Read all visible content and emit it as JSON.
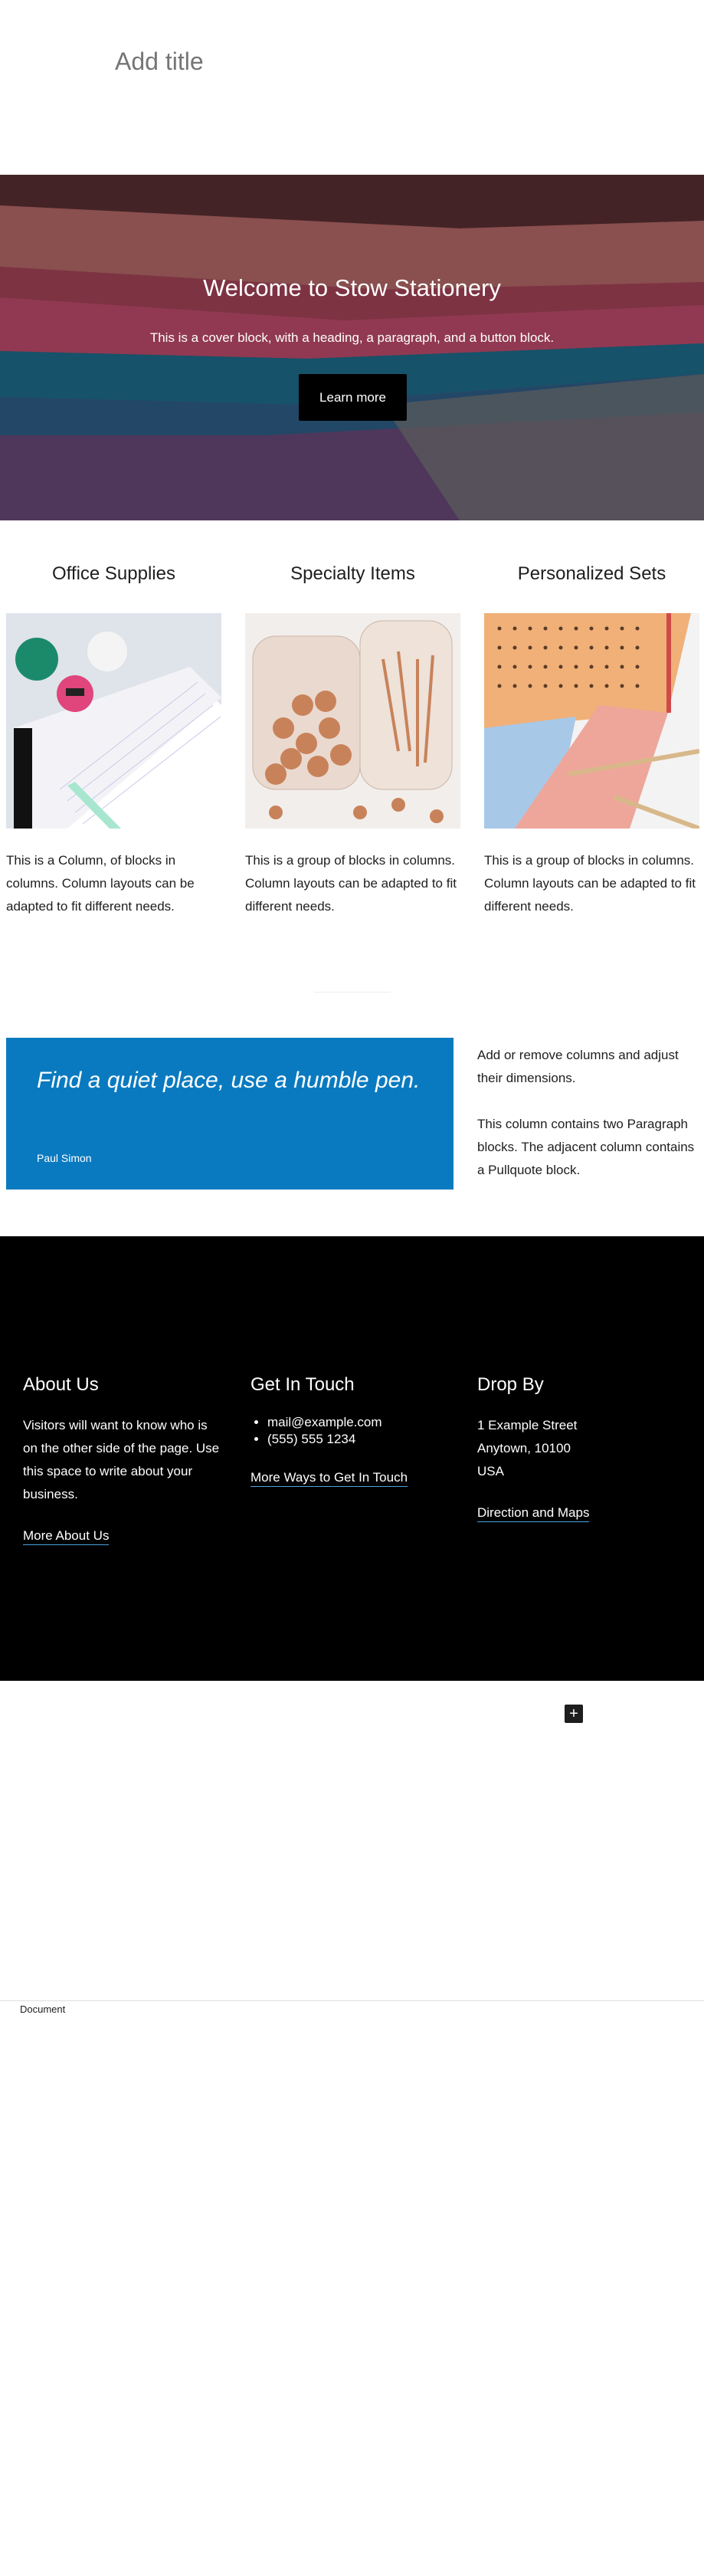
{
  "editor": {
    "title_placeholder": "Add title",
    "breadcrumb": "Document"
  },
  "cover": {
    "heading": "Welcome to Stow Stationery",
    "text": "This is a cover block, with a heading, a paragraph, and a button block.",
    "button_label": "Learn more"
  },
  "columns": [
    {
      "heading": "Office Supplies",
      "text": "This is a Column, of blocks in columns. Column layouts can be adapted to fit different needs."
    },
    {
      "heading": "Specialty Items",
      "text": "This is a group of blocks in columns. Column layouts can be adapted to fit different needs."
    },
    {
      "heading": "Personalized Sets",
      "text": "This is a group of blocks in columns. Column layouts can be adapted to fit different needs."
    }
  ],
  "pullquote": {
    "text": "Find a quiet place, use a humble pen.",
    "citation": "Paul Simon",
    "color": "#0a7ac0"
  },
  "side": {
    "p1": "Add or remove columns and adjust their dimensions.",
    "p2": "This column contains two Paragraph blocks. The adjacent column contains a Pullquote block."
  },
  "footer": {
    "about": {
      "heading": "About Us",
      "text": "Visitors will want to know who is on the other side of the page. Use this space to write about your business.",
      "link": "More About Us"
    },
    "contact": {
      "heading": "Get In Touch",
      "items": [
        "mail@example.com",
        "(555) 555 1234"
      ],
      "link": "More Ways to Get In Touch"
    },
    "location": {
      "heading": "Drop By",
      "lines": [
        "1 Example Street",
        "Anytown, 10100",
        "USA"
      ],
      "link": "Direction and Maps"
    }
  },
  "inserter_icon": "plus-icon"
}
